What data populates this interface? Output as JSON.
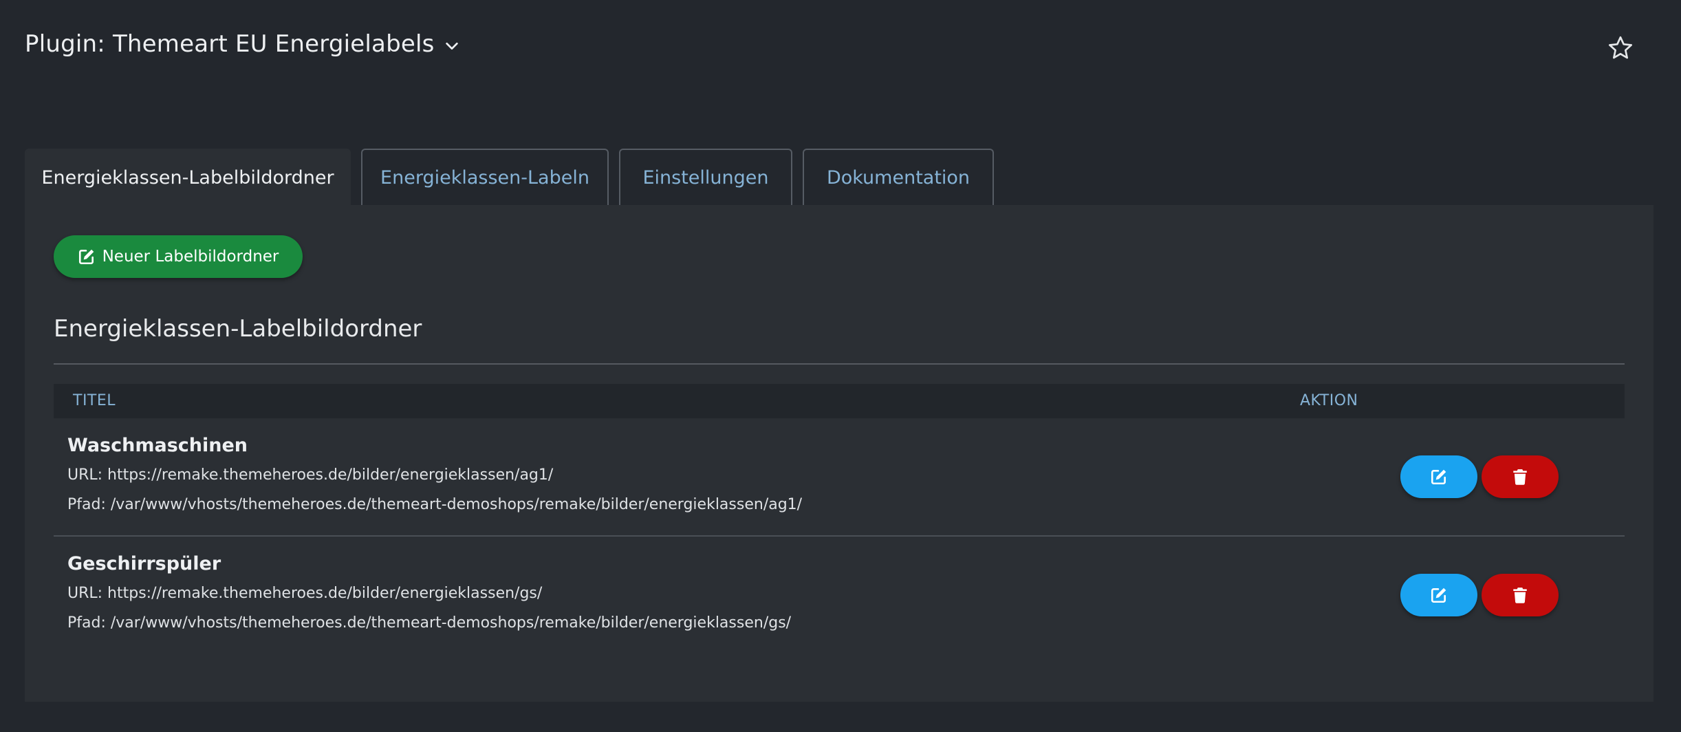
{
  "header": {
    "title": "Plugin: Themeart EU Energielabels"
  },
  "tabs": [
    {
      "label": "Energieklassen-Labelbildordner",
      "active": true
    },
    {
      "label": "Energieklassen-Labeln",
      "active": false
    },
    {
      "label": "Einstellungen",
      "active": false
    },
    {
      "label": "Dokumentation",
      "active": false
    }
  ],
  "toolbar": {
    "new_label": "Neuer Labelbildordner"
  },
  "section": {
    "title": "Energieklassen-Labelbildordner"
  },
  "table": {
    "headers": {
      "title": "TITEL",
      "action": "AKTION"
    },
    "rows": [
      {
        "title": "Waschmaschinen",
        "url": "URL: https://remake.themeheroes.de/bilder/energieklassen/ag1/",
        "path": "Pfad: /var/www/vhosts/themeheroes.de/themeart-demoshops/remake/bilder/energieklassen/ag1/"
      },
      {
        "title": "Geschirrspüler",
        "url": "URL: https://remake.themeheroes.de/bilder/energieklassen/gs/",
        "path": "Pfad: /var/www/vhosts/themeheroes.de/themeart-demoshops/remake/bilder/energieklassen/gs/"
      }
    ]
  },
  "icons": {
    "title_dropdown": "chevron-down-icon",
    "favorite": "star-icon",
    "new": "edit-icon",
    "row_edit": "edit-icon",
    "row_delete": "trash-icon"
  },
  "colors": {
    "background": "#23272d",
    "panel": "#2b2f34",
    "tab_link": "#86b3d6",
    "new_button": "#1a8a3e",
    "edit_button": "#1aa3f0",
    "delete_button": "#c30b0b"
  }
}
